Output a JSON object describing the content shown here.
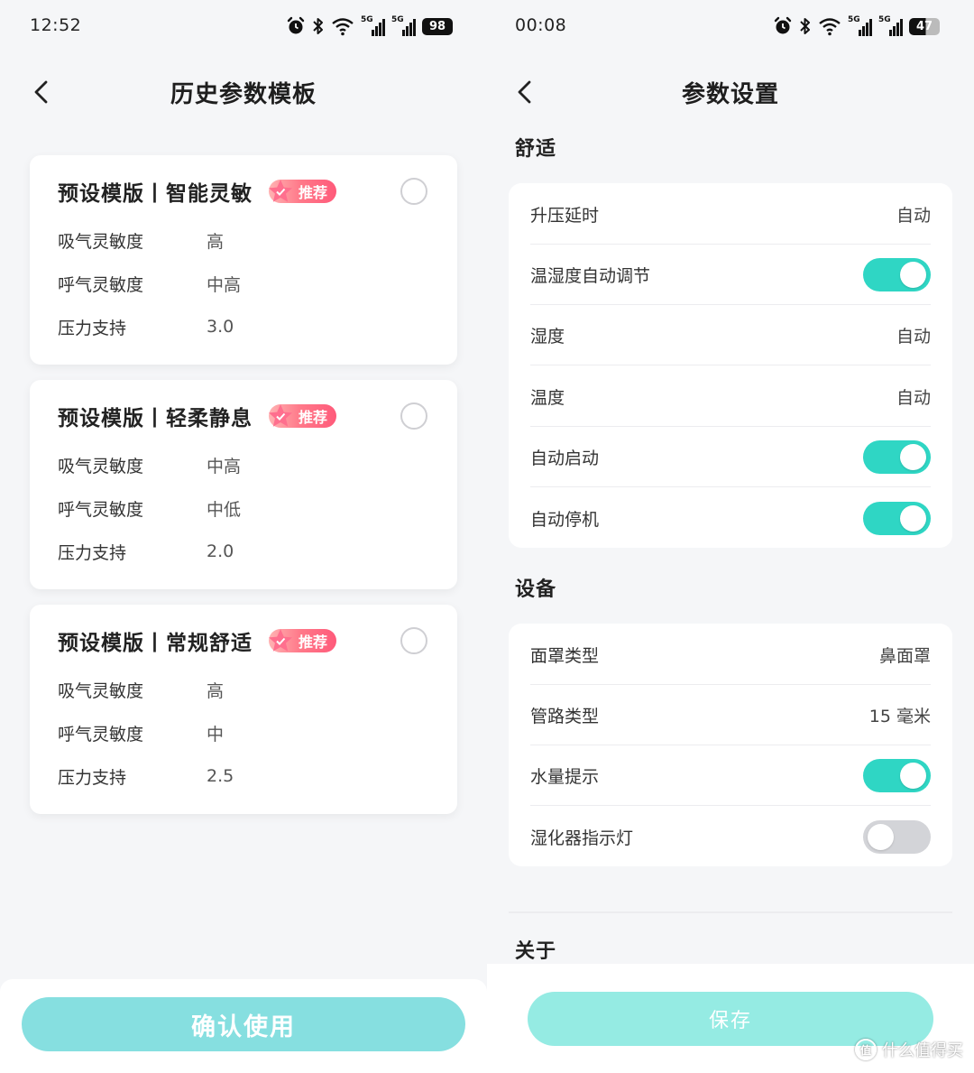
{
  "left": {
    "status": {
      "time": "12:52",
      "battery": "98",
      "sig1_label": "5G",
      "sig2_label": "5G"
    },
    "header": {
      "title": "历史参数模板"
    },
    "badge_label": "推荐",
    "cards": [
      {
        "title": "预设模版丨智能灵敏",
        "params": [
          {
            "label": "吸气灵敏度",
            "value": "高"
          },
          {
            "label": "呼气灵敏度",
            "value": "中高"
          },
          {
            "label": "压力支持",
            "value": "3.0"
          }
        ]
      },
      {
        "title": "预设模版丨轻柔静息",
        "params": [
          {
            "label": "吸气灵敏度",
            "value": "中高"
          },
          {
            "label": "呼气灵敏度",
            "value": "中低"
          },
          {
            "label": "压力支持",
            "value": "2.0"
          }
        ]
      },
      {
        "title": "预设模版丨常规舒适",
        "params": [
          {
            "label": "吸气灵敏度",
            "value": "高"
          },
          {
            "label": "呼气灵敏度",
            "value": "中"
          },
          {
            "label": "压力支持",
            "value": "2.5"
          }
        ]
      }
    ],
    "confirm_label": "确认使用"
  },
  "right": {
    "status": {
      "time": "00:08",
      "battery": "47",
      "sig1_label": "5G",
      "sig2_label": "5G"
    },
    "header": {
      "title": "参数设置"
    },
    "sections": {
      "comfort": {
        "title": "舒适",
        "rows": [
          {
            "label": "升压延时",
            "value": "自动"
          },
          {
            "label": "温湿度自动调节",
            "toggle": "on"
          },
          {
            "label": "湿度",
            "value": "自动"
          },
          {
            "label": "温度",
            "value": "自动"
          },
          {
            "label": "自动启动",
            "toggle": "on"
          },
          {
            "label": "自动停机",
            "toggle": "on"
          }
        ]
      },
      "device": {
        "title": "设备",
        "rows": [
          {
            "label": "面罩类型",
            "value": "鼻面罩"
          },
          {
            "label": "管路类型",
            "value": "15 毫米"
          },
          {
            "label": "水量提示",
            "toggle": "on"
          },
          {
            "label": "湿化器指示灯",
            "toggle": "off"
          }
        ]
      },
      "about": {
        "title": "关于"
      }
    },
    "save_label": "保存"
  },
  "watermark": {
    "text": "什么值得买",
    "logo_char": "值"
  },
  "colors": {
    "accent": "#2fd6c4",
    "confirm_button": "#86dfe0",
    "save_button": "#95ebe3",
    "badge": "#ff6a80",
    "background": "#f5f6f8"
  },
  "icons": {
    "back": "chevron-left-icon",
    "alarm": "alarm-icon",
    "bluetooth": "bluetooth-icon",
    "wifi": "wifi-icon",
    "signal": "signal-icon",
    "star": "star-icon"
  }
}
